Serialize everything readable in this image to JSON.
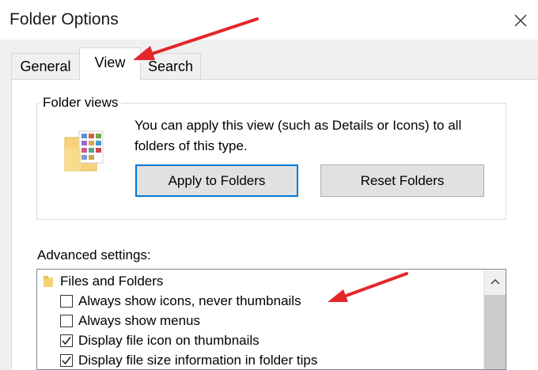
{
  "window": {
    "title": "Folder Options",
    "close_icon": "close-icon"
  },
  "tabs": [
    {
      "label": "General",
      "active": false
    },
    {
      "label": "View",
      "active": true
    },
    {
      "label": "Search",
      "active": false
    }
  ],
  "folder_views": {
    "label": "Folder views",
    "description": "You can apply this view (such as Details or Icons) to all folders of this type.",
    "apply_button": "Apply to Folders",
    "reset_button": "Reset Folders"
  },
  "advanced": {
    "label": "Advanced settings:",
    "items": [
      {
        "type": "folder",
        "label": "Files and Folders"
      },
      {
        "type": "checkbox",
        "label": "Always show icons, never thumbnails",
        "checked": false
      },
      {
        "type": "checkbox",
        "label": "Always show menus",
        "checked": false
      },
      {
        "type": "checkbox",
        "label": "Display file icon on thumbnails",
        "checked": true
      },
      {
        "type": "checkbox",
        "label": "Display file size information in folder tips",
        "checked": true
      }
    ]
  },
  "colors": {
    "accent": "#0078d7",
    "annotation": "#e3262b"
  }
}
